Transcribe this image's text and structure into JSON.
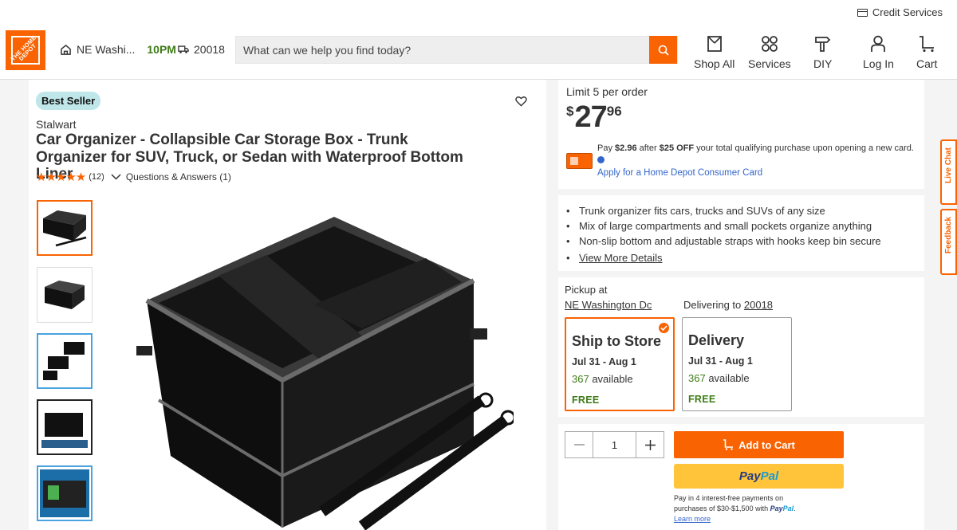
{
  "header": {
    "credit_services": "Credit Services",
    "logo_text": "THE HOME DEPOT",
    "store_name": "NE Washi...",
    "store_hours": "10PM",
    "zip": "20018",
    "search_placeholder": "What can we help you find today?",
    "nav": [
      {
        "label": "Shop All",
        "icon": "shop-all-icon"
      },
      {
        "label": "Services",
        "icon": "services-icon"
      },
      {
        "label": "DIY",
        "icon": "diy-icon"
      },
      {
        "label": "Log In",
        "icon": "user-icon"
      },
      {
        "label": "Cart",
        "icon": "cart-icon"
      }
    ]
  },
  "product": {
    "badge": "Best Seller",
    "brand": "Stalwart",
    "title": "Car Organizer - Collapsible Car Storage Box - Trunk Organizer for SUV, Truck, or Sedan with Waterproof Bottom Liner",
    "rating_stars": "★★★★★",
    "rating_value": 5,
    "review_count": "(12)",
    "qa": "Questions & Answers (1)"
  },
  "pricing": {
    "limit": "Limit 5 per order",
    "currency": "$",
    "dollars": "27",
    "cents": "96",
    "pay_prefix": "Pay",
    "pay_amount": "$2.96",
    "pay_after": "after",
    "pay_off": "$25 OFF",
    "pay_rest": "your total qualifying purchase upon opening a new card.",
    "apply_link": "Apply for a Home Depot Consumer Card"
  },
  "highlights": [
    "Trunk organizer fits cars, trucks and SUVs of any size",
    "Mix of large compartments and small pockets organize anything",
    "Non-slip bottom and adjustable straps with hooks keep bin secure"
  ],
  "view_more": "View More Details",
  "fulfillment": {
    "pickup_label": "Pickup at",
    "pickup_store": "NE Washington Dc",
    "delivering_label": "Delivering to",
    "delivering_zip": "20018",
    "options": [
      {
        "title": "Ship to Store",
        "dates": "Jul 31 - Aug 1",
        "available_count": "367",
        "available_label": "available",
        "price": "FREE",
        "selected": true
      },
      {
        "title": "Delivery",
        "dates": "Jul 31 - Aug 1",
        "available_count": "367",
        "available_label": "available",
        "price": "FREE",
        "selected": false
      }
    ]
  },
  "cart": {
    "quantity": "1",
    "add_to_cart": "Add to Cart",
    "paypal_pay": "Pay",
    "paypal_pal": "Pal",
    "paypal_line1": "Pay in 4 interest-free payments on",
    "paypal_line2": "purchases of $30-$1,500 with",
    "paypal_learn": "Learn more"
  },
  "side_tabs": {
    "live_chat": "Live Chat",
    "feedback": "Feedback"
  },
  "colors": {
    "brand_orange": "#f96302",
    "available_green": "#3e7c17",
    "link_blue": "#3366cc",
    "badge_teal": "#bfe6e9"
  }
}
